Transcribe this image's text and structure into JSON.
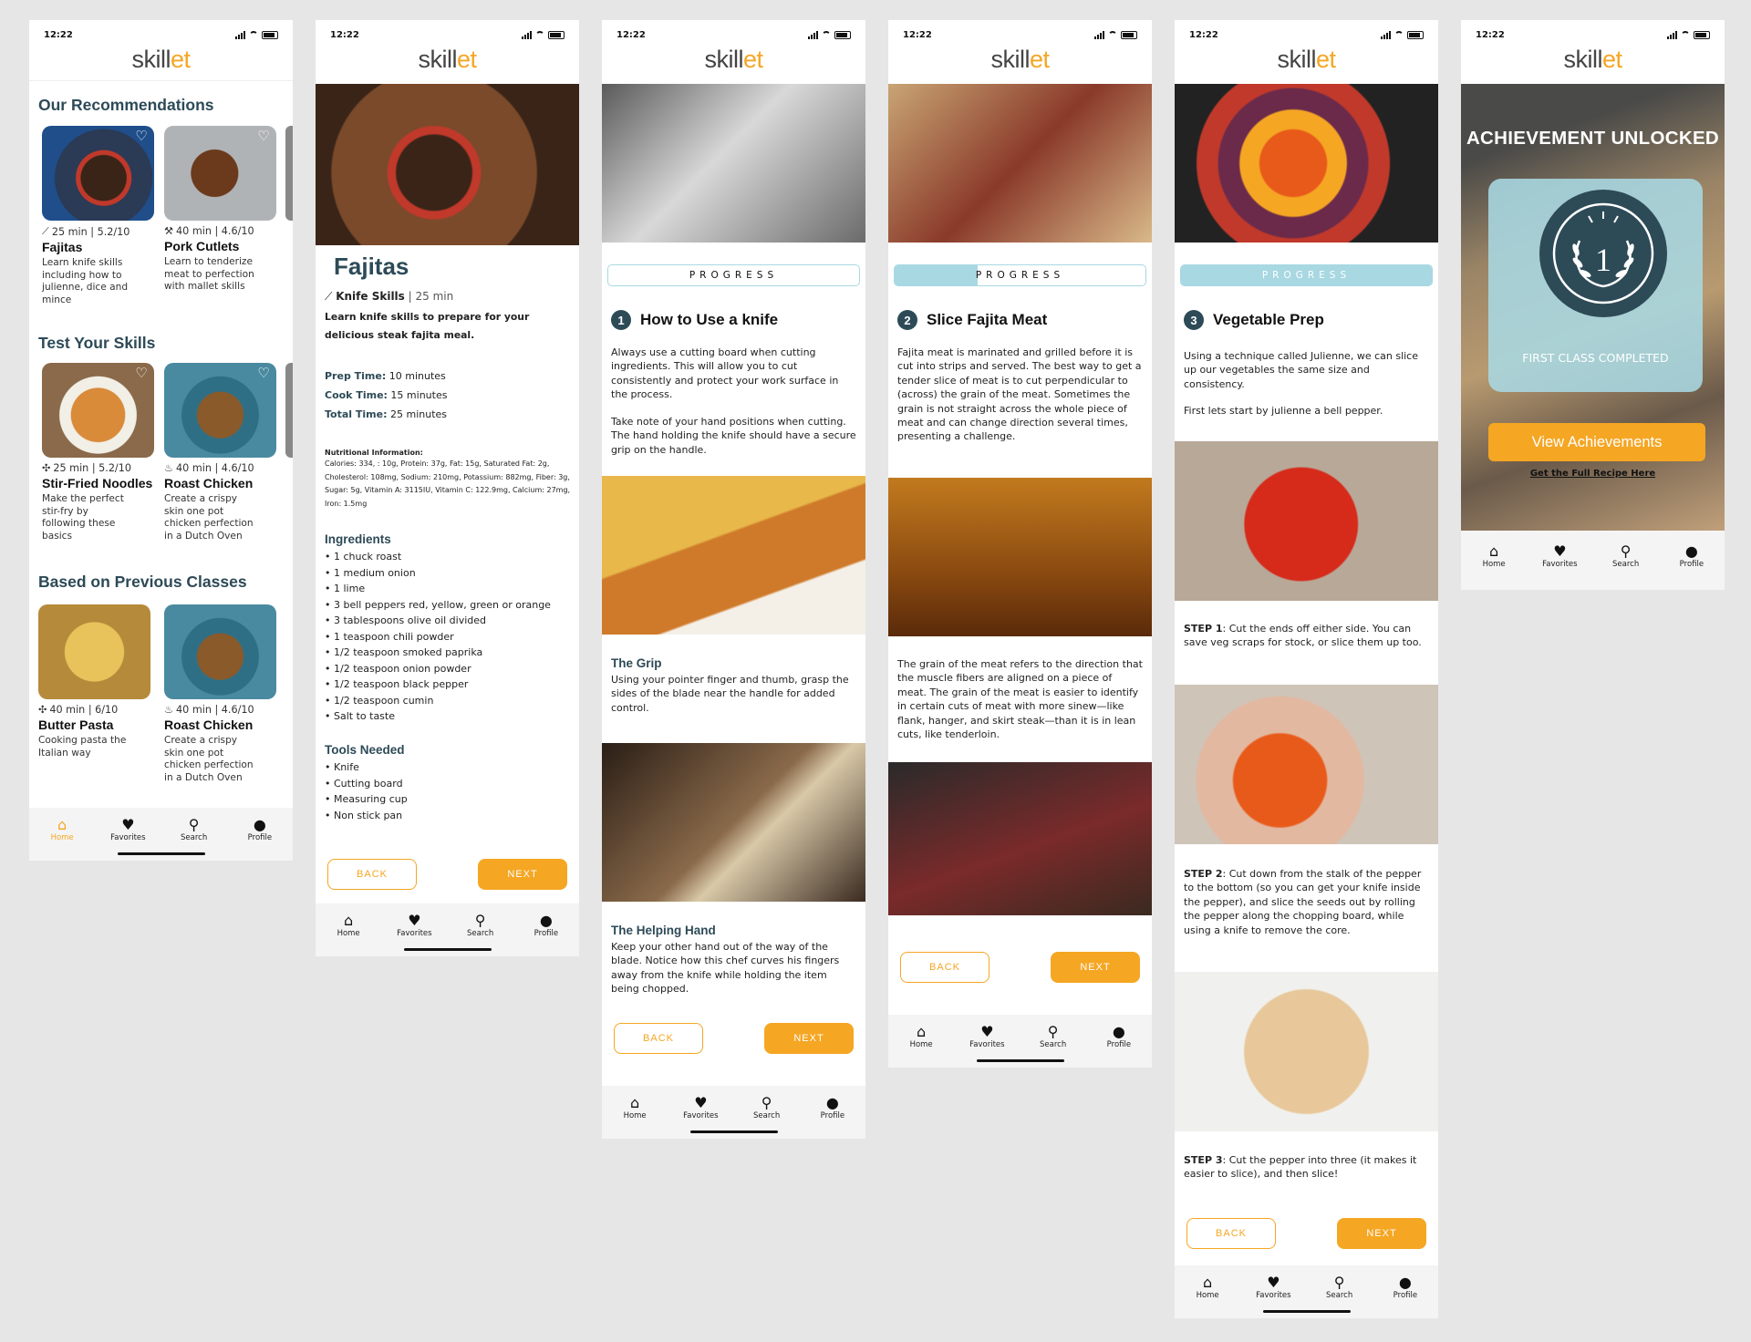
{
  "status_time": "12:22",
  "logo": {
    "a": "skill",
    "b": "et"
  },
  "tabs": [
    "Home",
    "Favorites",
    "Search",
    "Profile"
  ],
  "colors": {
    "accent": "#f5a623",
    "dark": "#2d4a57",
    "progress": "#a8d8e2"
  },
  "screen1": {
    "sec1": "Our Recommendations",
    "sec2": "Test Your Skills",
    "sec3": "Based on Previous Classes",
    "cards": [
      {
        "meta": "25 min | 5.2/10",
        "title": "Fajitas",
        "desc": "Learn knife skills including how to julienne, dice and mince"
      },
      {
        "meta": "40 min | 4.6/10",
        "title": "Pork Cutlets",
        "desc": "Learn to tenderize meat to perfection with mallet skills"
      },
      {
        "meta": "25 min | 5.2/10",
        "title": "Stir-Fried Noodles",
        "desc": "Make the perfect stir-fry by following these basics"
      },
      {
        "meta": "40 min | 4.6/10",
        "title": "Roast Chicken",
        "desc": "Create a crispy skin one pot chicken perfection in a Dutch Oven"
      },
      {
        "meta": "40 min | 6/10",
        "title": "Butter Pasta",
        "desc": "Cooking pasta the Italian way"
      },
      {
        "meta": "40 min | 4.6/10",
        "title": "Roast Chicken",
        "desc": "Create a crispy skin one pot chicken perfection in a Dutch Oven"
      }
    ]
  },
  "screen2": {
    "title": "Fajitas",
    "skill": "Knife Skills",
    "time": " | 25 min",
    "intro": "Learn knife skills to prepare for your delicious steak fajita meal.",
    "prep_label": "Prep Time:",
    "prep": " 10 minutes",
    "cook_label": "Cook Time:",
    "cook": " 15 minutes",
    "total_label": "Total Time:",
    "total": " 25 minutes",
    "nutrition_label": "Nutritional Information:",
    "nutrition": "Calories: 334,      : 10g, Protein: 37g, Fat: 15g, Saturated Fat: 2g, Cholesterol: 108mg, Sodium: 210mg, Potassium: 882mg, Fiber: 3g, Sugar: 5g, Vitamin A: 3115IU, Vitamin C: 122.9mg, Calcium: 27mg, Iron: 1.5mg",
    "ingredients_label": "Ingredients",
    "ingredients": [
      "1 chuck roast",
      "1 medium onion",
      "1 lime",
      "3 bell peppers red, yellow, green or orange",
      "3 tablespoons olive oil divided",
      "1 teaspoon chili powder",
      "1/2 teaspoon smoked paprika",
      "1/2 teaspoon onion powder",
      "1/2 teaspoon black pepper",
      "1/2 teaspoon cumin",
      "Salt to taste"
    ],
    "tools_label": "Tools Needed",
    "tools": [
      "Knife",
      "Cutting board",
      "Measuring cup",
      "Non stick pan"
    ],
    "back": "BACK",
    "next": "NEXT"
  },
  "screen3": {
    "progress": "PROGRESS",
    "progress_value": 0,
    "num": "1",
    "title": "How to Use a knife",
    "p1": "Always use a cutting board when cutting ingredients. This will allow you to cut consistently and protect your work surface in the process.",
    "p2": "Take note of your hand positions when cutting. The hand holding the knife should have a secure grip on the handle.",
    "grip_title": "The Grip",
    "grip": "Using your pointer finger and thumb, grasp the sides of the blade near the handle for added control.",
    "help_title": "The Helping Hand",
    "help": "Keep your other hand out of the  way of the blade. Notice how this  chef curves his fingers away from  the knife while holding the item being chopped.",
    "back": "BACK",
    "next": "NEXT"
  },
  "screen4": {
    "progress": "PROGRESS",
    "progress_value": 0.33,
    "num": "2",
    "title": "Slice Fajita Meat",
    "p1": "Fajita meat is marinated and grilled before it is cut into strips and served. The best way to get a tender slice of meat is to cut perpendicular to (across) the grain of the meat. Sometimes the grain is not straight across the whole piece of meat and can change direction several times, presenting a challenge.",
    "p2": "The grain of the meat refers to the direction that the muscle fibers are aligned on a piece of meat. The grain of the meat is easier to identify in certain cuts of meat with more sinew—like flank, hanger, and skirt steak—than it is in lean cuts, like tenderloin.",
    "back": "BACK",
    "next": "NEXT"
  },
  "screen5": {
    "progress": "PROGRESS",
    "progress_value": 1,
    "num": "3",
    "title": "Vegetable Prep",
    "p1": "Using a technique called Julienne, we can slice up our vegetables the same size and consistency.",
    "p2": "First lets start by julienne a bell pepper.",
    "s1_label": "STEP 1",
    "s1": ": Cut the ends off either side. You  can save veg scraps for stock, or slice them up too.",
    "s2_label": "STEP 2",
    "s2": ": Cut down from the stalk of the pepper to the bottom (so you  can get your knife inside the pepper), and slice the seeds out by rolling  the pepper along the chopping  board, while using a knife to remove the core.",
    "s3_label": "STEP 3",
    "s3": ":  Cut the pepper into three (it makes it easier to slice), and then slice!",
    "back": "BACK",
    "next": "NEXT"
  },
  "screen6": {
    "title": "ACHIEVEMENT UNLOCKED",
    "badge_num": "1",
    "badge_caption": "FIRST CLASS COMPLETED",
    "cta": "View Achievements",
    "link": "Get the Full Recipe Here"
  }
}
